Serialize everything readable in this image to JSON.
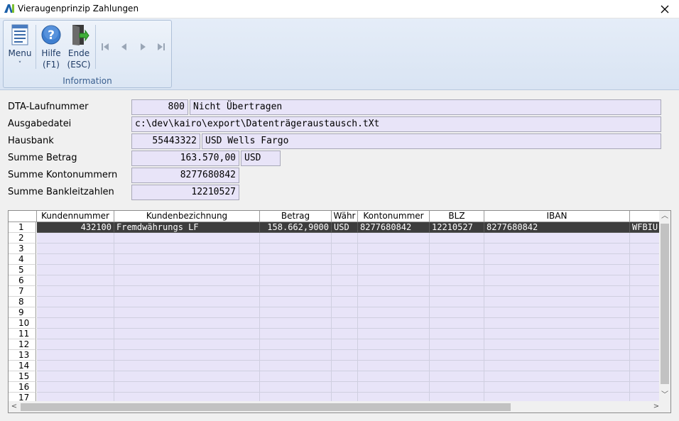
{
  "window": {
    "logo_text": "A",
    "title": "Vieraugenprinzip Zahlungen"
  },
  "ribbon": {
    "group_label": "Information",
    "buttons": [
      {
        "label_line1": "Menu",
        "label_line2": "˅",
        "icon": "menu-list-icon"
      },
      {
        "label_line1": "Hilfe",
        "label_line2": "(F1)",
        "icon": "help-icon"
      },
      {
        "label_line1": "Ende",
        "label_line2": "(ESC)",
        "icon": "exit-door-icon"
      }
    ],
    "nav": [
      "first-record-icon",
      "previous-record-icon",
      "next-record-icon",
      "last-record-icon"
    ]
  },
  "form": {
    "dta_laufnummer": {
      "label": "DTA-Laufnummer",
      "value": "800",
      "status": "Nicht Übertragen"
    },
    "ausgabedatei": {
      "label": "Ausgabedatei",
      "value": "c:\\dev\\kairo\\export\\Datenträgeraustausch.tXt"
    },
    "hausbank": {
      "label": "Hausbank",
      "value": "55443322",
      "name": "USD Wells Fargo"
    },
    "summe_betrag": {
      "label": "Summe Betrag",
      "value": "163.570,00",
      "currency": "USD"
    },
    "summe_kontonummern": {
      "label": "Summe Kontonummern",
      "value": "8277680842"
    },
    "summe_bankleitzahlen": {
      "label": "Summe Bankleitzahlen",
      "value": "12210527"
    }
  },
  "grid": {
    "columns": [
      "Kundennummer",
      "Kundenbezichnung",
      "Betrag",
      "Währ",
      "Kontonummer",
      "BLZ",
      "IBAN",
      ""
    ],
    "row_numbers": [
      "1",
      "2",
      "3",
      "4",
      "5",
      "6",
      "7",
      "8",
      "9",
      "10",
      "11",
      "12",
      "13",
      "14",
      "15",
      "16",
      "17"
    ],
    "rows": [
      [
        "432100",
        "Fremdwährungs LF",
        "158.662,9000",
        "USD",
        "8277680842",
        "12210527",
        "8277680842",
        "WFBIU"
      ]
    ]
  },
  "colors": {
    "field_bg": "#e8e4f8",
    "selected_row": "#3d3d3d",
    "ribbon_text": "#1f3c66"
  }
}
